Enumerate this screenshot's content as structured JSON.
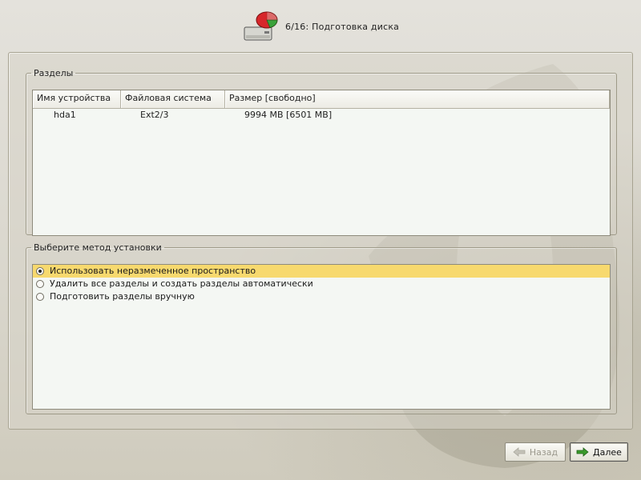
{
  "header": {
    "title": "6/16: Подготовка диска",
    "icon": "disk-partition-icon"
  },
  "partitions": {
    "legend": "Разделы",
    "columns": [
      "Имя устройства",
      "Файловая система",
      "Размер [свободно]"
    ],
    "rows": [
      {
        "device": "hda1",
        "filesystem": "Ext2/3",
        "size": "9994 MB [6501 MB]"
      }
    ]
  },
  "install_method": {
    "legend": "Выберите метод установки",
    "options": [
      {
        "label": "Использовать неразмеченное пространство",
        "selected": true
      },
      {
        "label": "Удалить все разделы и создать разделы автоматически",
        "selected": false
      },
      {
        "label": "Подготовить разделы вручную",
        "selected": false
      }
    ]
  },
  "buttons": {
    "back_label": "Назад",
    "back_enabled": false,
    "next_label": "Далее"
  },
  "colors": {
    "selection": "#f7d96e",
    "arrow_green": "#3a9a2c"
  }
}
